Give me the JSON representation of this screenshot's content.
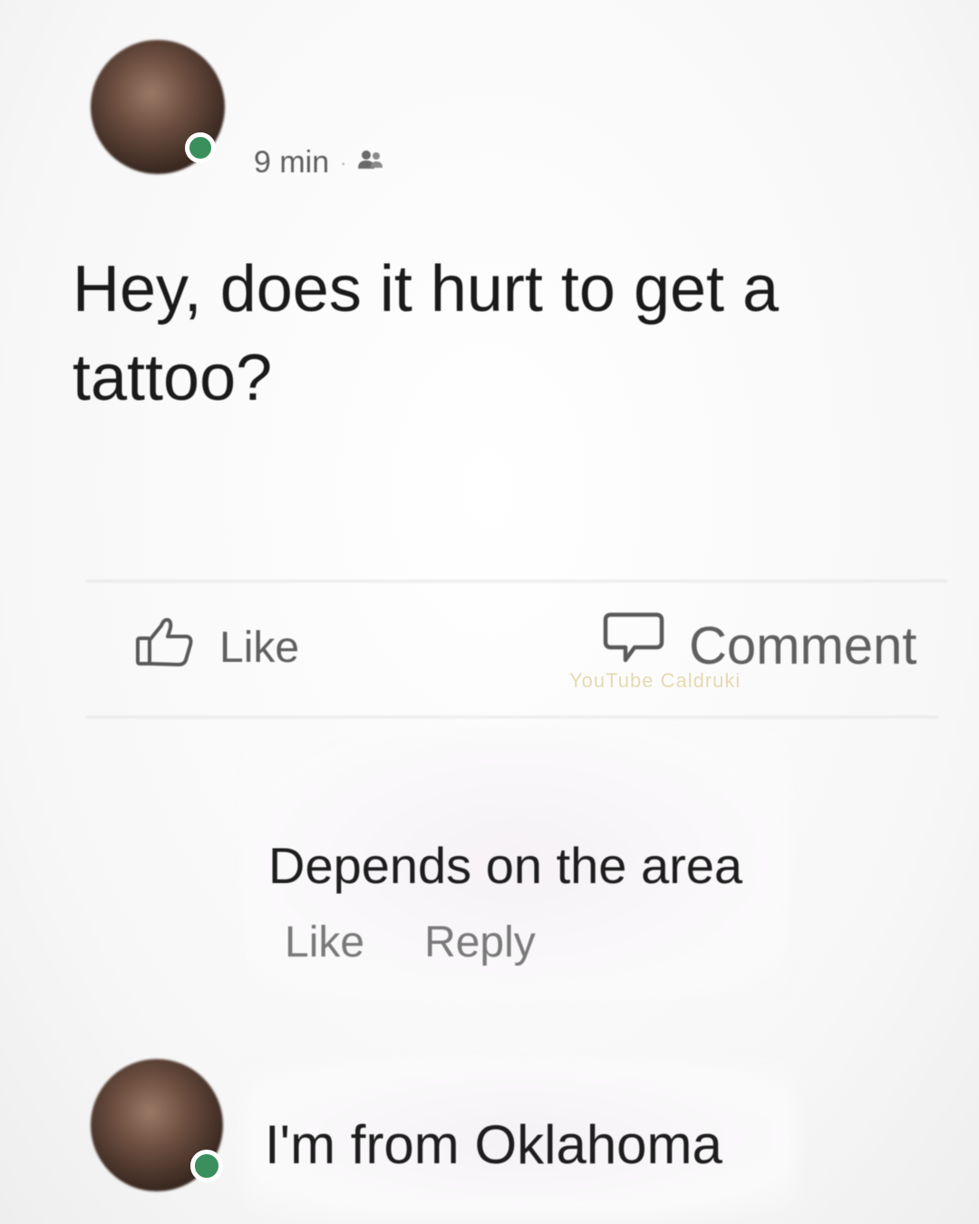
{
  "post": {
    "time": "9 min",
    "audience_icon": "friends-icon",
    "text": "Hey, does it hurt to get a tattoo?"
  },
  "actions": {
    "like_label": "Like",
    "like_icon": "thumbs-up-icon",
    "comment_label": "Comment",
    "comment_icon": "speech-bubble-icon"
  },
  "watermark": "YouTube Caldruki",
  "comment": {
    "text": "Depends on the area",
    "like_label": "Like",
    "reply_label": "Reply"
  },
  "reply": {
    "text": "I'm from Oklahoma"
  },
  "colors": {
    "online_dot": "#3a8f5c",
    "watermark": "#e7d9b3"
  }
}
